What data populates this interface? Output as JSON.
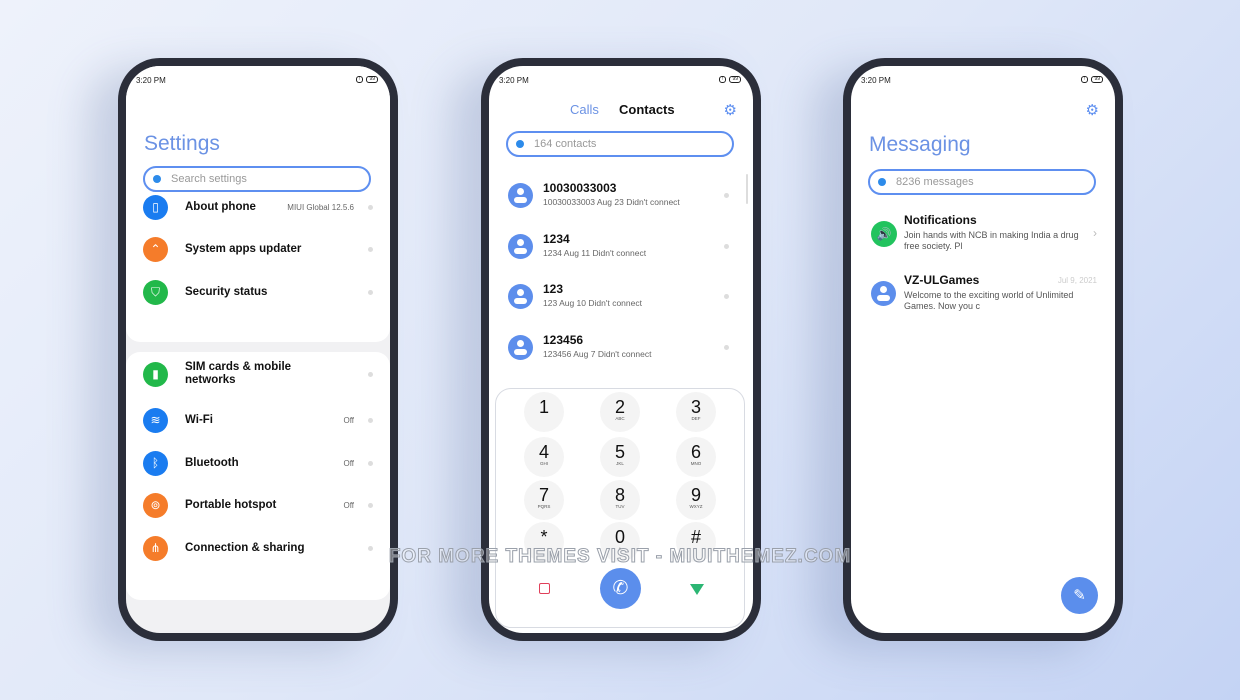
{
  "status": {
    "time": "3:20 PM",
    "battery": "99"
  },
  "settings": {
    "title": "Settings",
    "search_placeholder": "Search settings",
    "items": [
      {
        "label": "About phone",
        "value": "MIUI Global 12.5.6",
        "icon": "phone-icon",
        "color": "#1a7cf0"
      },
      {
        "label": "System apps updater",
        "value": "",
        "icon": "chevrons-up-icon",
        "color": "#f57c2a"
      },
      {
        "label": "Security status",
        "value": "",
        "icon": "shield-icon",
        "color": "#22b84a"
      },
      {
        "label": "SIM cards & mobile networks",
        "value": "",
        "icon": "signal-icon",
        "color": "#22b84a"
      },
      {
        "label": "Wi-Fi",
        "value": "Off",
        "icon": "wifi-icon",
        "color": "#1a7cf0"
      },
      {
        "label": "Bluetooth",
        "value": "Off",
        "icon": "bluetooth-icon",
        "color": "#1a7cf0"
      },
      {
        "label": "Portable hotspot",
        "value": "Off",
        "icon": "hotspot-icon",
        "color": "#f57c2a"
      },
      {
        "label": "Connection & sharing",
        "value": "",
        "icon": "share-icon",
        "color": "#f57c2a"
      }
    ]
  },
  "dialer": {
    "tabs": [
      "Calls",
      "Contacts"
    ],
    "search_placeholder": "164 contacts",
    "calls": [
      {
        "name": "10030033003",
        "detail": "10030033003  Aug 23 Didn't connect"
      },
      {
        "name": "1234",
        "detail": "1234  Aug 11 Didn't connect"
      },
      {
        "name": "123",
        "detail": "123  Aug 10 Didn't connect"
      },
      {
        "name": "123456",
        "detail": "123456  Aug 7 Didn't connect"
      }
    ],
    "keys": [
      [
        "1",
        ""
      ],
      [
        "2",
        "ABC"
      ],
      [
        "3",
        "DEF"
      ],
      [
        "4",
        "GHI"
      ],
      [
        "5",
        "JKL"
      ],
      [
        "6",
        "MNO"
      ],
      [
        "7",
        "PQRS"
      ],
      [
        "8",
        "TUV"
      ],
      [
        "9",
        "WXYZ"
      ],
      [
        "*",
        ""
      ],
      [
        "0",
        "+"
      ],
      [
        "#",
        ""
      ]
    ]
  },
  "messaging": {
    "title": "Messaging",
    "search_placeholder": "8236 messages",
    "threads": [
      {
        "name": "Notifications",
        "text": "Join hands with NCB in making India a drug free society. Pl",
        "date": ""
      },
      {
        "name": "VZ-ULGames",
        "text": "Welcome to the exciting world of Unlimited Games. Now you c",
        "date": "Jul 9, 2021"
      }
    ]
  },
  "watermark": "FOR MORE THEMES VISIT - MIUITHEMEZ.COM",
  "colors": {
    "accent": "#5e8ff0",
    "frame": "#2b2e3a"
  }
}
